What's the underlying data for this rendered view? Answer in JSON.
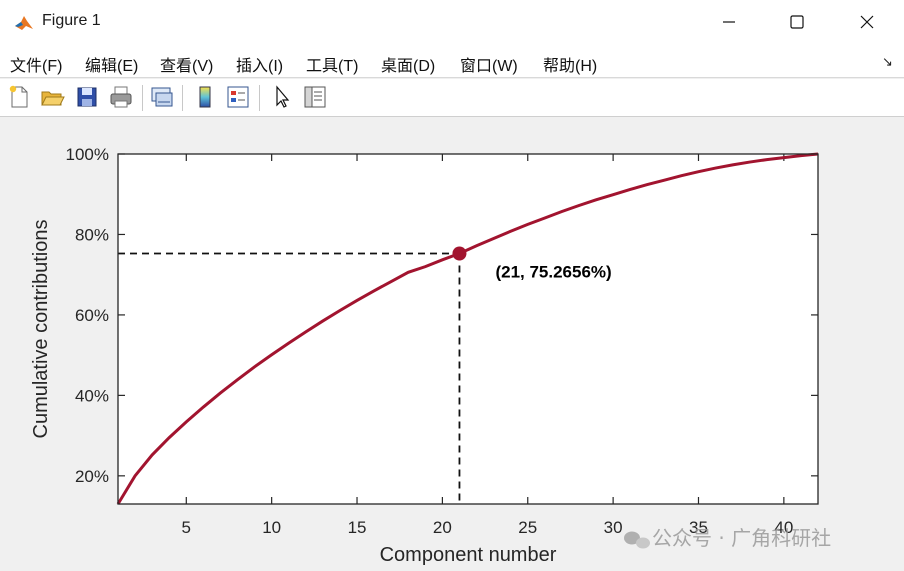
{
  "window": {
    "title": "Figure 1"
  },
  "menu": [
    "文件(F)",
    "编辑(E)",
    "查看(V)",
    "插入(I)",
    "工具(T)",
    "桌面(D)",
    "窗口(W)",
    "帮助(H)"
  ],
  "toolbar_icons": [
    "new-figure-icon",
    "open-file-icon",
    "save-icon",
    "print-icon",
    "link-plot-icon",
    "colorbar-icon",
    "legend-icon",
    "edit-plot-pointer-icon",
    "property-inspector-icon"
  ],
  "watermark": "公众号 · 广角科研社",
  "chart_data": {
    "type": "line",
    "xlabel": "Component number",
    "ylabel": "Cumulative contributions",
    "xlim": [
      1,
      42
    ],
    "ylim": [
      13,
      100
    ],
    "xticks": [
      5,
      10,
      15,
      20,
      25,
      30,
      35,
      40
    ],
    "yticks": [
      20,
      40,
      60,
      80,
      100
    ],
    "ytick_labels": [
      "20%",
      "40%",
      "60%",
      "80%",
      "100%"
    ],
    "x": [
      1,
      2,
      3,
      4,
      5,
      6,
      7,
      8,
      9,
      10,
      11,
      12,
      13,
      14,
      15,
      16,
      17,
      18,
      19,
      20,
      21,
      22,
      23,
      24,
      25,
      26,
      27,
      28,
      29,
      30,
      31,
      32,
      33,
      34,
      35,
      36,
      37,
      38,
      39,
      40,
      41,
      42
    ],
    "series": [
      {
        "color": "#a2142f",
        "values": [
          13.0,
          20.0,
          25.2,
          29.5,
          33.4,
          37.1,
          40.6,
          43.9,
          47.1,
          50.1,
          53.0,
          55.8,
          58.5,
          61.1,
          63.6,
          66.0,
          68.3,
          70.6,
          72.0,
          73.7,
          75.27,
          77.2,
          79.0,
          80.8,
          82.5,
          84.1,
          85.7,
          87.2,
          88.6,
          89.9,
          91.2,
          92.4,
          93.5,
          94.6,
          95.6,
          96.5,
          97.3,
          98.0,
          98.6,
          99.1,
          99.6,
          100.0
        ]
      }
    ],
    "highlight": {
      "x": 21,
      "y": 75.2656,
      "label": "(21, 75.2656%)",
      "color": "#a2142f"
    }
  }
}
